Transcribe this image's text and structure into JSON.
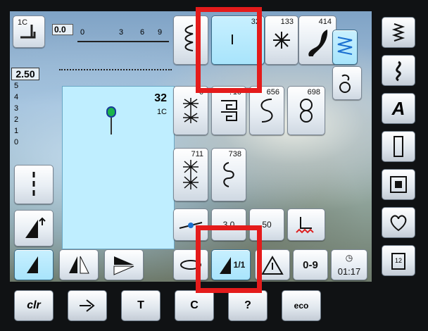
{
  "stitch_width": {
    "presser_foot": "1C",
    "value": "0.0",
    "scale": [
      "0",
      "3",
      "6",
      "9"
    ]
  },
  "stitch_length": {
    "value": "2.50",
    "scale": [
      "5",
      "4",
      "3",
      "2",
      "1",
      "0"
    ]
  },
  "stitch_preview": {
    "number": "32",
    "foot": "1C"
  },
  "stitch_grid": [
    {
      "number": "",
      "icon": "satin-scallop-icon"
    },
    {
      "number": "32",
      "icon": "straight-stitch-icon",
      "selected": true
    },
    {
      "number": "133",
      "icon": "flower-motif-icon"
    },
    {
      "number": "414",
      "icon": "swirl-shape-icon"
    },
    {
      "number": "6",
      "icon": "star-flower-icon"
    },
    {
      "number": "?10",
      "icon": "greek-key-icon"
    },
    {
      "number": "656",
      "icon": "s-curve-icon"
    },
    {
      "number": "698",
      "icon": "figure-eight-icon"
    },
    {
      "number": "711",
      "icon": "asterisk-stitch-icon"
    },
    {
      "number": "738",
      "icon": "spiral-stitch-icon"
    }
  ],
  "settings_row": {
    "tension": "",
    "pressure": "3.0",
    "needle_stop": "50",
    "feed_dog": ""
  },
  "bottom_row": {
    "mirror_label": "1/1",
    "alt_number_label": "0-9",
    "clock": "01:17"
  },
  "bottom_bar": {
    "clr": "clr",
    "eco": "eco",
    "t_label": "T",
    "c_label": "C",
    "q_label": "?",
    "page": "12"
  },
  "sidebar_letter": "A",
  "colors": {
    "highlight": "#e41b1b",
    "selected_bg": "#bfeeff"
  }
}
